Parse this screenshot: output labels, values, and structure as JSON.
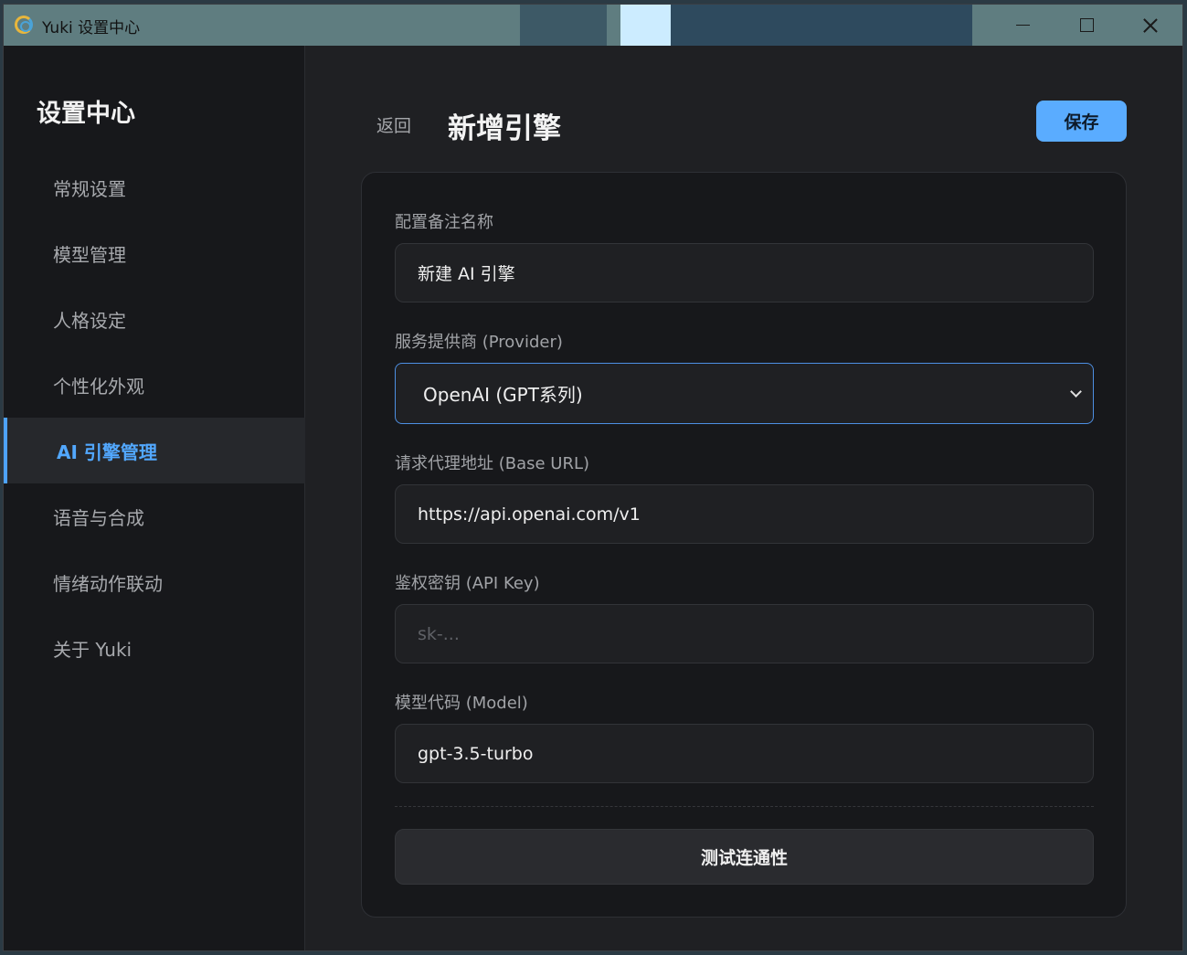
{
  "window": {
    "title": "Yuki 设置中心"
  },
  "sidebar": {
    "title": "设置中心",
    "items": [
      {
        "label": "常规设置",
        "active": false
      },
      {
        "label": "模型管理",
        "active": false
      },
      {
        "label": "人格设定",
        "active": false
      },
      {
        "label": "个性化外观",
        "active": false
      },
      {
        "label": "AI 引擎管理",
        "active": true
      },
      {
        "label": "语音与合成",
        "active": false
      },
      {
        "label": "情绪动作联动",
        "active": false
      },
      {
        "label": "关于 Yuki",
        "active": false
      }
    ]
  },
  "header": {
    "back_label": "返回",
    "title": "新增引擎",
    "save_label": "保存"
  },
  "form": {
    "name": {
      "label": "配置备注名称",
      "value": "新建 AI 引擎"
    },
    "provider": {
      "label": "服务提供商 (Provider)",
      "value": "OpenAI (GPT系列)"
    },
    "base_url": {
      "label": "请求代理地址 (Base URL)",
      "value": "https://api.openai.com/v1"
    },
    "api_key": {
      "label": "鉴权密钥 (API Key)",
      "value": "",
      "placeholder": "sk-..."
    },
    "model": {
      "label": "模型代码 (Model)",
      "value": "gpt-3.5-turbo"
    },
    "test_label": "测试连通性"
  },
  "colors": {
    "accent": "#5aacff",
    "active_nav": "#52a8ff",
    "background": "#17181b",
    "main_background": "#1f2023"
  }
}
